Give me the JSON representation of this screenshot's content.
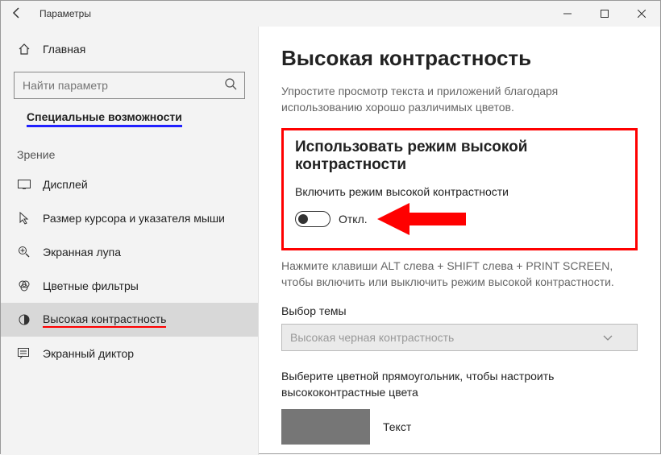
{
  "window": {
    "title": "Параметры"
  },
  "sidebar": {
    "home": "Главная",
    "search_placeholder": "Найти параметр",
    "category": "Специальные возможности",
    "subhead": "Зрение",
    "items": [
      {
        "label": "Дисплей"
      },
      {
        "label": "Размер курсора и указателя мыши"
      },
      {
        "label": "Экранная лупа"
      },
      {
        "label": "Цветные фильтры"
      },
      {
        "label": "Высокая контрастность"
      },
      {
        "label": "Экранный диктор"
      }
    ]
  },
  "main": {
    "title": "Высокая контрастность",
    "desc": "Упростите просмотр текста и приложений благодаря использованию хорошо различимых цветов.",
    "section_title": "Использовать режим высокой контрастности",
    "toggle_label": "Включить режим высокой контрастности",
    "toggle_state": "Откл.",
    "hint": "Нажмите клавиши ALT слева + SHIFT слева + PRINT SCREEN, чтобы включить или выключить режим высокой контрастности.",
    "theme_label": "Выбор темы",
    "theme_value": "Высокая черная контрастность",
    "swatch_label": "Выберите цветной прямоугольник, чтобы настроить высококонтрастные цвета",
    "swatch_text": "Текст"
  }
}
